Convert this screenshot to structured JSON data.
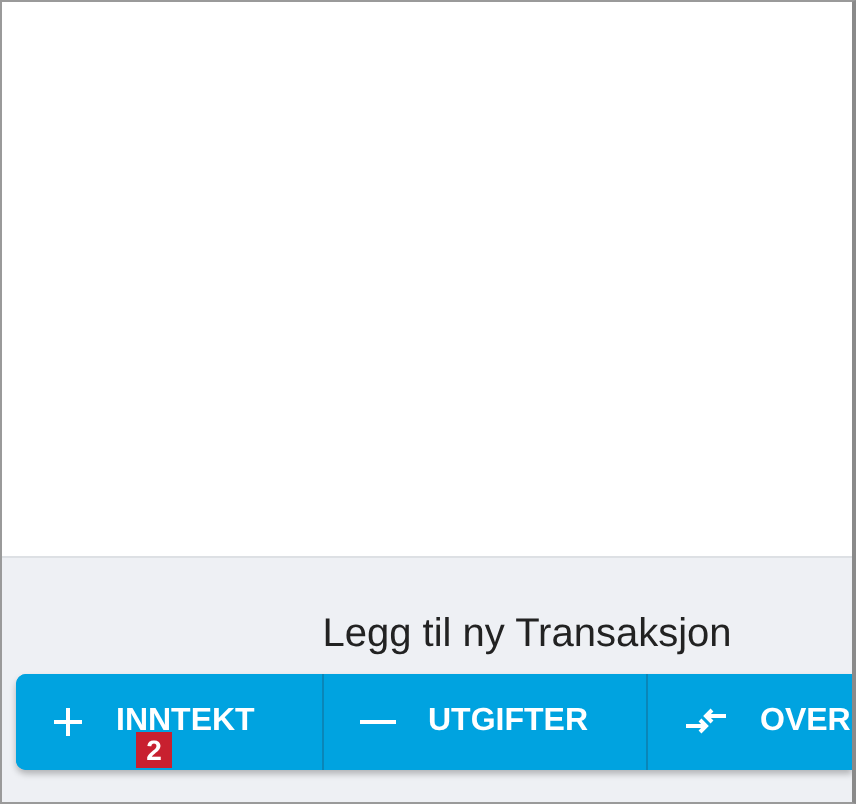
{
  "footer": {
    "title": "Legg til ny Transaksjon"
  },
  "buttons": [
    {
      "kind": "plus",
      "label": "INNTEKT"
    },
    {
      "kind": "minus",
      "label": "UTGIFTER"
    },
    {
      "kind": "transfer",
      "label": "OVER"
    }
  ],
  "callout": "2"
}
